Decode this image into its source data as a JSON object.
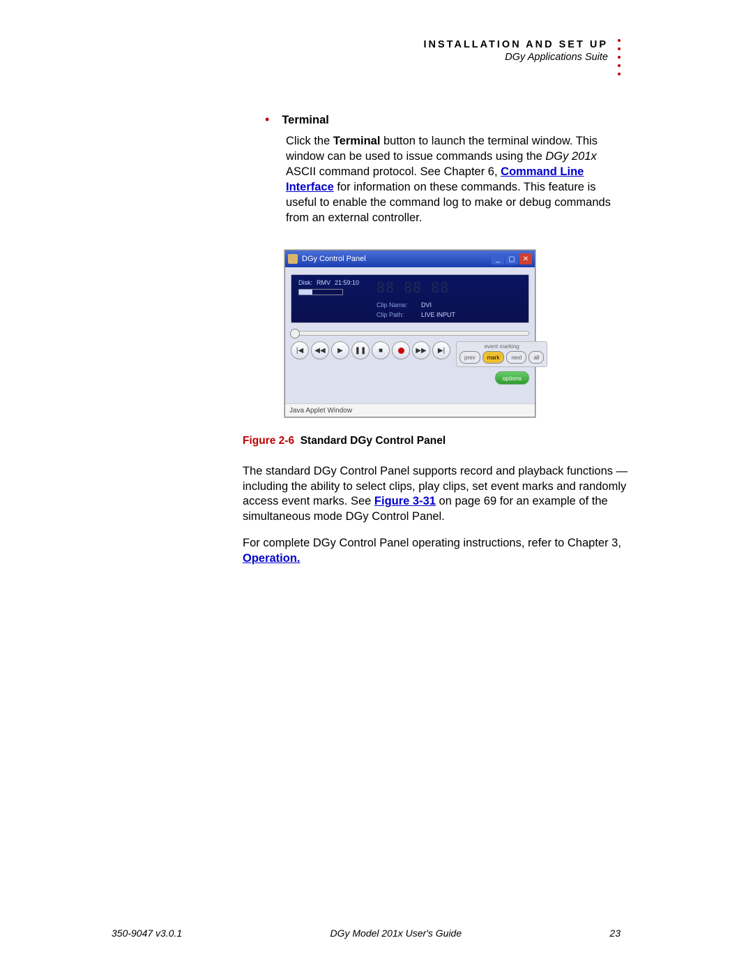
{
  "header": {
    "title": "INSTALLATION AND SET UP",
    "subtitle": "DGy Applications Suite"
  },
  "section": {
    "bullet_title": "Terminal",
    "para1_a": "Click the ",
    "para1_b": "Terminal",
    "para1_c": " button to launch the terminal window. This window can be used to issue commands using the ",
    "para1_d": "DGy 201x",
    "para1_e": " ASCII command protocol. See Chapter 6, ",
    "link1": "Command Line Interface",
    "para1_f": " for information on these commands. This feature is useful to enable the command log to make or debug commands from an external controller."
  },
  "figure": {
    "window_title": "DGy Control Panel",
    "disk_label": "Disk:",
    "disk_mode": "RMV",
    "disk_time": "21:59:10",
    "timecode": "88 88 88",
    "clip_name_label": "Clip Name:",
    "clip_name": "DVI",
    "clip_path_label": "Clip Path:",
    "clip_path": "LIVE INPUT",
    "event_marking": "event marking",
    "prev": "prev",
    "mark": "mark",
    "next": "next",
    "all": "all",
    "options": "options",
    "applet": "Java Applet Window"
  },
  "caption": {
    "label": "Figure 2-6",
    "text": "Standard DGy Control Panel"
  },
  "body": {
    "p1_a": "The standard DGy Control Panel supports record and playback functions — including the ability to select clips, play clips, set event marks and randomly access event marks. See ",
    "p1_link": "Figure 3-31",
    "p1_b": " on page 69 for an example of the simultaneous mode DGy Control Panel.",
    "p2_a": "For complete DGy Control Panel operating instructions, refer to Chapter 3, ",
    "p2_link": "Operation.",
    "p2_b": ""
  },
  "footer": {
    "left": "350-9047 v3.0.1",
    "center": "DGy Model 201x User's Guide",
    "right": "23"
  }
}
